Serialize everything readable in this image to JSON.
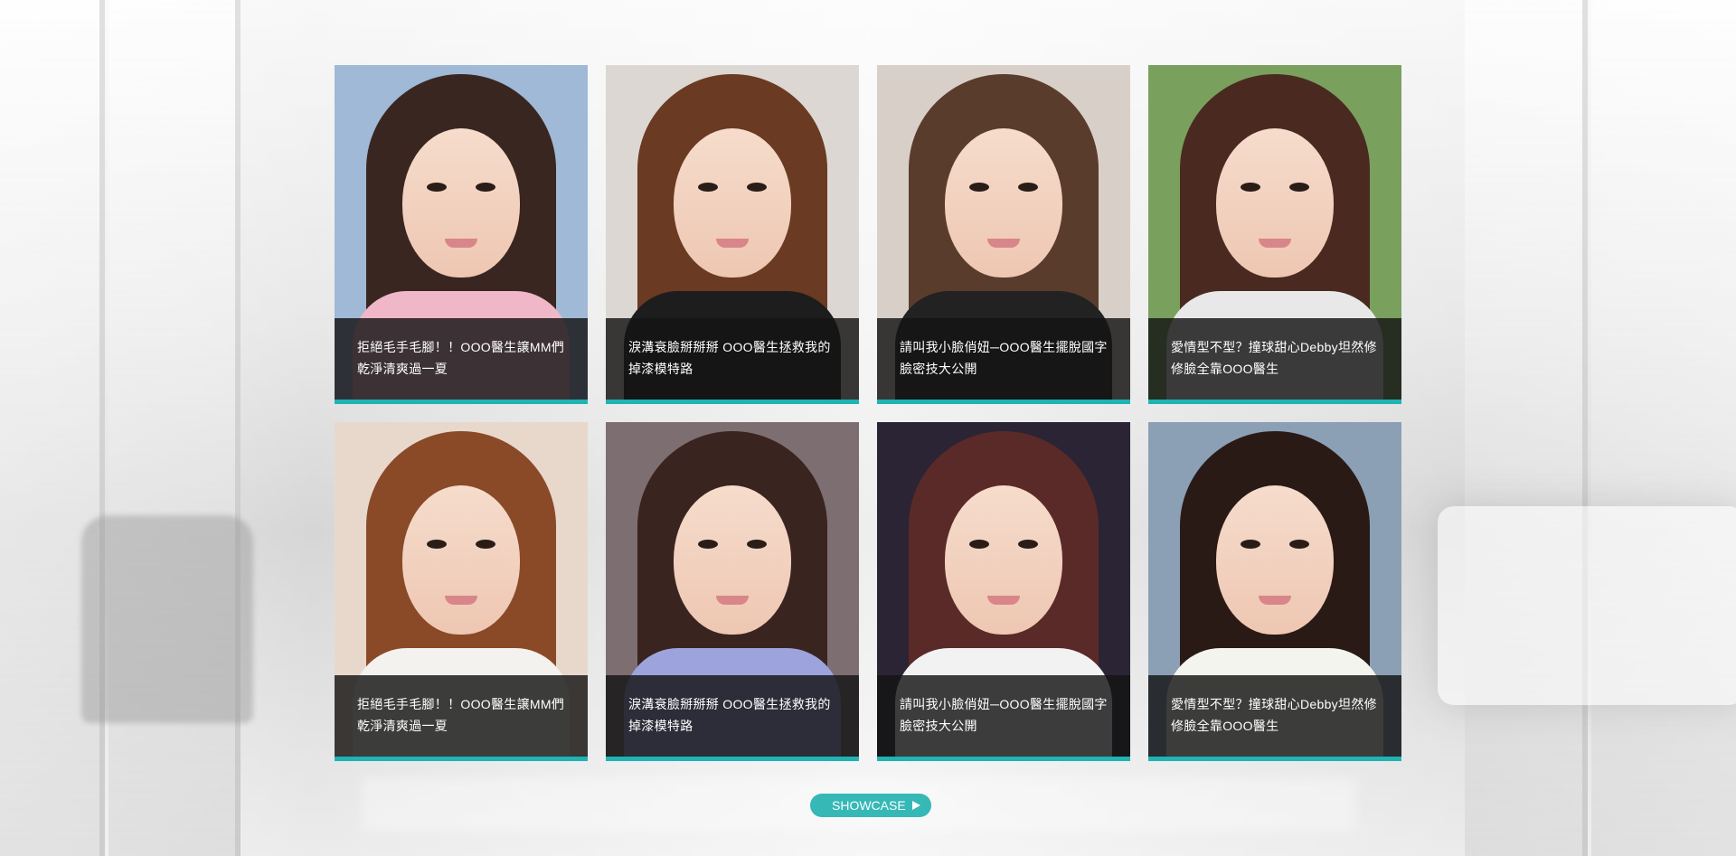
{
  "theme": {
    "accent": "#1fb3b4",
    "button": "#35b8b6",
    "caption_bg": "#141414"
  },
  "cards": [
    {
      "title": "拒絕毛手毛腳！！OOO醫生譲MM們乾淨清爽過一夏",
      "photo": {
        "bg": "#9fb9d6",
        "hair": "#3a2620",
        "shirt": "#f0b7c8"
      }
    },
    {
      "title": "淚溝衰臉掰掰掰 OOO醫生拯救我的掉漆模特路",
      "photo": {
        "bg": "#dcd7d2",
        "hair": "#6a3a22",
        "shirt": "#1d1d1d"
      }
    },
    {
      "title": "請叫我小臉俏妞─OOO醫生擺脫國字臉密技大公開",
      "photo": {
        "bg": "#d8d0c8",
        "hair": "#5a3c2c",
        "shirt": "#222222"
      }
    },
    {
      "title": "愛情型不型？撞球甜心Debby坦然修修臉全靠OOO醫生",
      "photo": {
        "bg": "#7aa05e",
        "hair": "#4a2a20",
        "shirt": "#e8e8e8"
      }
    },
    {
      "title": "拒絕毛手毛腳！！OOO醫生譲MM們乾淨清爽過一夏",
      "photo": {
        "bg": "#e8d8cc",
        "hair": "#8a4a28",
        "shirt": "#f4f2ee"
      }
    },
    {
      "title": "淚溝衰臉掰掰掰 OOO醫生拯救我的掉漆模特路",
      "photo": {
        "bg": "#7d6e72",
        "hair": "#3a2420",
        "shirt": "#9da3dc"
      }
    },
    {
      "title": "請叫我小臉俏妞─OOO醫生擺脫國字臉密技大公開",
      "photo": {
        "bg": "#2a2434",
        "hair": "#5a2a28",
        "shirt": "#f2f2f2"
      }
    },
    {
      "title": "愛情型不型？撞球甜心Debby坦然修修臉全靠OOO醫生",
      "photo": {
        "bg": "#8ba0b4",
        "hair": "#2a1a16",
        "shirt": "#f4f4ee"
      }
    }
  ],
  "showcase": {
    "label": "SHOWCASE",
    "icon": "play-icon"
  }
}
